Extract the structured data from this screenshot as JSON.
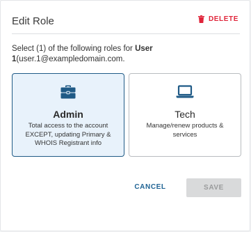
{
  "dialog": {
    "title": "Edit Role",
    "delete_label": "DELETE",
    "instructions": {
      "prefix": "Select (1) of the following roles for ",
      "user_name": "User 1",
      "user_email": "(user.1@exampledomain.com."
    },
    "roles": [
      {
        "name": "Admin",
        "description": "Total access to the account EXCEPT, updating Primary & WHOIS Registrant info",
        "icon": "briefcase-icon",
        "selected": true
      },
      {
        "name": "Tech",
        "description": "Manage/renew products & services",
        "icon": "laptop-icon",
        "selected": false
      }
    ],
    "cancel_label": "CANCEL",
    "save_label": "SAVE",
    "colors": {
      "accent": "#1f5a86",
      "delete": "#e0243a",
      "selected_bg": "#e8f2fb",
      "disabled_bg": "#d9dadb"
    }
  }
}
